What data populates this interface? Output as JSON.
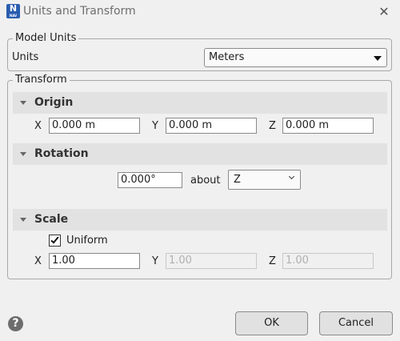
{
  "window": {
    "title": "Units and Transform",
    "app_icon": {
      "letter": "N",
      "sub": "NAV"
    },
    "close_glyph": "✕"
  },
  "model_units": {
    "group_title": "Model Units",
    "units_label": "Units",
    "units_value": "Meters"
  },
  "transform": {
    "group_title": "Transform",
    "origin": {
      "header": "Origin",
      "x_label": "X",
      "x_value": "0.000 m",
      "y_label": "Y",
      "y_value": "0.000 m",
      "z_label": "Z",
      "z_value": "0.000 m"
    },
    "rotation": {
      "header": "Rotation",
      "angle_value": "0.000°",
      "about_label": "about",
      "axis_value": "Z"
    },
    "scale": {
      "header": "Scale",
      "uniform_label": "Uniform",
      "uniform_checked": true,
      "x_label": "X",
      "x_value": "1.00",
      "y_label": "Y",
      "y_value": "1.00",
      "z_label": "Z",
      "z_value": "1.00"
    }
  },
  "footer": {
    "help_glyph": "?",
    "ok_label": "OK",
    "cancel_label": "Cancel"
  }
}
